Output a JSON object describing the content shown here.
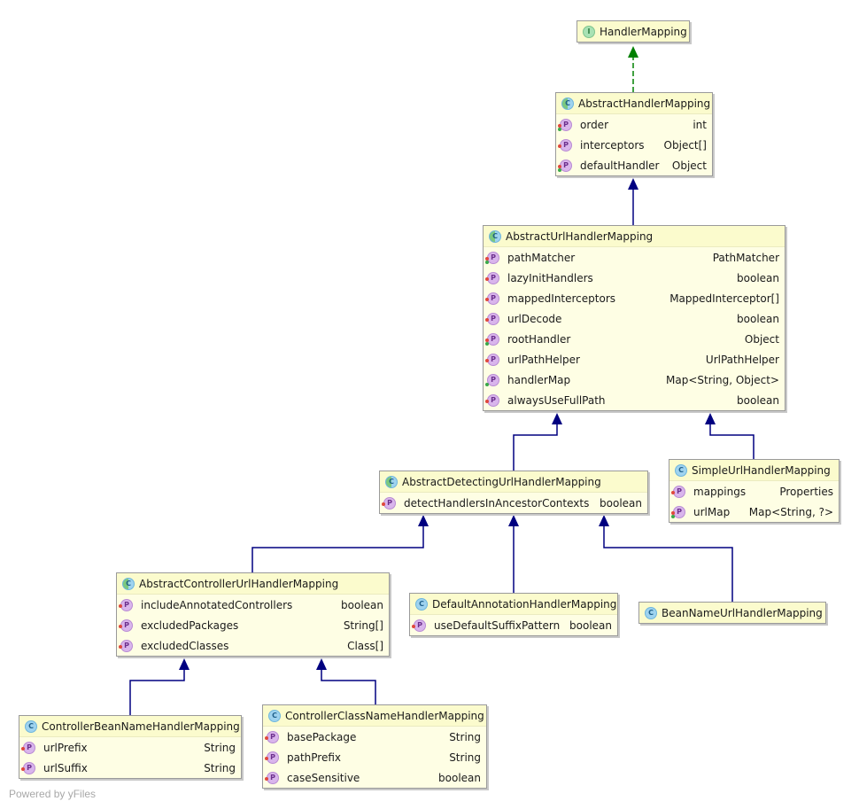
{
  "diagram": {
    "nodes": {
      "handlerMapping": {
        "kind": "interface",
        "name": "HandlerMapping",
        "fields": []
      },
      "abstractHandlerMapping": {
        "kind": "abstract",
        "name": "AbstractHandlerMapping",
        "fields": [
          {
            "name": "order",
            "type": "int",
            "marks": [
              "red",
              "green"
            ]
          },
          {
            "name": "interceptors",
            "type": "Object[]",
            "marks": [
              "red"
            ]
          },
          {
            "name": "defaultHandler",
            "type": "Object",
            "marks": [
              "red",
              "green"
            ]
          }
        ]
      },
      "abstractUrlHandlerMapping": {
        "kind": "abstract",
        "name": "AbstractUrlHandlerMapping",
        "fields": [
          {
            "name": "pathMatcher",
            "type": "PathMatcher",
            "marks": [
              "red",
              "green"
            ]
          },
          {
            "name": "lazyInitHandlers",
            "type": "boolean",
            "marks": [
              "red"
            ]
          },
          {
            "name": "mappedInterceptors",
            "type": "MappedInterceptor[]",
            "marks": [
              "red"
            ]
          },
          {
            "name": "urlDecode",
            "type": "boolean",
            "marks": [
              "red"
            ]
          },
          {
            "name": "rootHandler",
            "type": "Object",
            "marks": [
              "red",
              "green"
            ]
          },
          {
            "name": "urlPathHelper",
            "type": "UrlPathHelper",
            "marks": [
              "red"
            ]
          },
          {
            "name": "handlerMap",
            "type": "Map<String, Object>",
            "marks": [
              "green"
            ]
          },
          {
            "name": "alwaysUseFullPath",
            "type": "boolean",
            "marks": [
              "red"
            ]
          }
        ]
      },
      "abstractDetectingUrlHandlerMapping": {
        "kind": "abstract",
        "name": "AbstractDetectingUrlHandlerMapping",
        "fields": [
          {
            "name": "detectHandlersInAncestorContexts",
            "type": "boolean",
            "marks": [
              "red"
            ]
          }
        ]
      },
      "simpleUrlHandlerMapping": {
        "kind": "class",
        "name": "SimpleUrlHandlerMapping",
        "fields": [
          {
            "name": "mappings",
            "type": "Properties",
            "marks": [
              "red"
            ]
          },
          {
            "name": "urlMap",
            "type": "Map<String, ?>",
            "marks": [
              "red",
              "green"
            ]
          }
        ]
      },
      "abstractControllerUrlHandlerMapping": {
        "kind": "abstract",
        "name": "AbstractControllerUrlHandlerMapping",
        "fields": [
          {
            "name": "includeAnnotatedControllers",
            "type": "boolean",
            "marks": [
              "red"
            ]
          },
          {
            "name": "excludedPackages",
            "type": "String[]",
            "marks": [
              "red"
            ]
          },
          {
            "name": "excludedClasses",
            "type": "Class[]",
            "marks": [
              "red"
            ]
          }
        ]
      },
      "defaultAnnotationHandlerMapping": {
        "kind": "class",
        "name": "DefaultAnnotationHandlerMapping",
        "fields": [
          {
            "name": "useDefaultSuffixPattern",
            "type": "boolean",
            "marks": [
              "red"
            ]
          }
        ]
      },
      "beanNameUrlHandlerMapping": {
        "kind": "class",
        "name": "BeanNameUrlHandlerMapping",
        "fields": []
      },
      "controllerBeanNameHandlerMapping": {
        "kind": "class",
        "name": "ControllerBeanNameHandlerMapping",
        "fields": [
          {
            "name": "urlPrefix",
            "type": "String",
            "marks": [
              "red"
            ]
          },
          {
            "name": "urlSuffix",
            "type": "String",
            "marks": [
              "red"
            ]
          }
        ]
      },
      "controllerClassNameHandlerMapping": {
        "kind": "class",
        "name": "ControllerClassNameHandlerMapping",
        "fields": [
          {
            "name": "basePackage",
            "type": "String",
            "marks": [
              "red"
            ]
          },
          {
            "name": "pathPrefix",
            "type": "String",
            "marks": [
              "red"
            ]
          },
          {
            "name": "caseSensitive",
            "type": "boolean",
            "marks": [
              "red"
            ]
          }
        ]
      }
    },
    "edges": [
      {
        "from": "abstractHandlerMapping",
        "to": "handlerMapping",
        "type": "implements"
      },
      {
        "from": "abstractUrlHandlerMapping",
        "to": "abstractHandlerMapping",
        "type": "extends"
      },
      {
        "from": "abstractDetectingUrlHandlerMapping",
        "to": "abstractUrlHandlerMapping",
        "type": "extends"
      },
      {
        "from": "simpleUrlHandlerMapping",
        "to": "abstractUrlHandlerMapping",
        "type": "extends"
      },
      {
        "from": "abstractControllerUrlHandlerMapping",
        "to": "abstractDetectingUrlHandlerMapping",
        "type": "extends"
      },
      {
        "from": "defaultAnnotationHandlerMapping",
        "to": "abstractDetectingUrlHandlerMapping",
        "type": "extends"
      },
      {
        "from": "beanNameUrlHandlerMapping",
        "to": "abstractDetectingUrlHandlerMapping",
        "type": "extends"
      },
      {
        "from": "controllerBeanNameHandlerMapping",
        "to": "abstractControllerUrlHandlerMapping",
        "type": "extends"
      },
      {
        "from": "controllerClassNameHandlerMapping",
        "to": "abstractControllerUrlHandlerMapping",
        "type": "extends"
      }
    ],
    "colors": {
      "extends": "#000080",
      "implements": "#008000"
    },
    "icon_letters": {
      "interface": "I",
      "class": "C",
      "abstract": "C",
      "property": "P"
    }
  },
  "footer": "Powered by yFiles"
}
